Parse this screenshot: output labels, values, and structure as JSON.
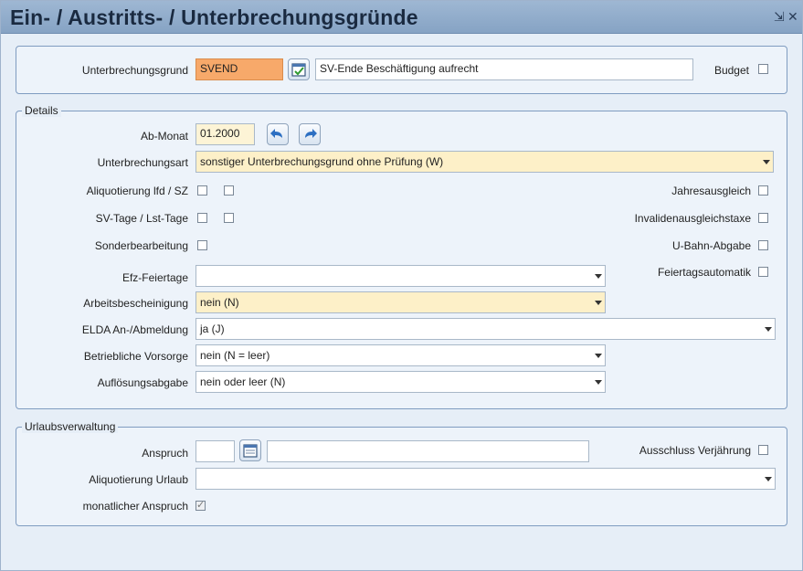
{
  "window": {
    "title": "Ein- / Austritts- / Unterbrechungsgründe"
  },
  "top": {
    "unterbrechungsgrund_label": "Unterbrechungsgrund",
    "code_value": "SVEND",
    "description_value": "SV-Ende Beschäftigung aufrecht",
    "budget_label": "Budget"
  },
  "details": {
    "legend": "Details",
    "ab_monat_label": "Ab-Monat",
    "ab_monat_value": "01.2000",
    "unterbrechungsart_label": "Unterbrechungsart",
    "unterbrechungsart_value": "sonstiger Unterbrechungsgrund ohne Prüfung (W)",
    "aliquotierung_label": "Aliquotierung lfd / SZ",
    "svtage_label": "SV-Tage / Lst-Tage",
    "sonder_label": "Sonderbearbeitung",
    "jahresausgleich_label": "Jahresausgleich",
    "invaliden_label": "Invalidenausgleichstaxe",
    "ubahn_label": "U-Bahn-Abgabe",
    "feiertagsautomatik_label": "Feiertagsautomatik",
    "efz_label": "Efz-Feiertage",
    "efz_value": "",
    "arbeitsbescheinigung_label": "Arbeitsbescheinigung",
    "arbeitsbescheinigung_value": "nein (N)",
    "elda_label": "ELDA An-/Abmeldung",
    "elda_value": "ja (J)",
    "vorsorge_label": "Betriebliche Vorsorge",
    "vorsorge_value": "nein (N = leer)",
    "aufloesung_label": "Auflösungsabgabe",
    "aufloesung_value": "nein oder leer (N)"
  },
  "urlaub": {
    "legend": "Urlaubsverwaltung",
    "anspruch_label": "Anspruch",
    "anspruch_value": "",
    "anspruch_text": "",
    "ausschluss_label": "Ausschluss Verjährung",
    "aliquotierung_urlaub_label": "Aliquotierung Urlaub",
    "aliquotierung_urlaub_value": "",
    "monatlicher_label": "monatlicher Anspruch"
  }
}
